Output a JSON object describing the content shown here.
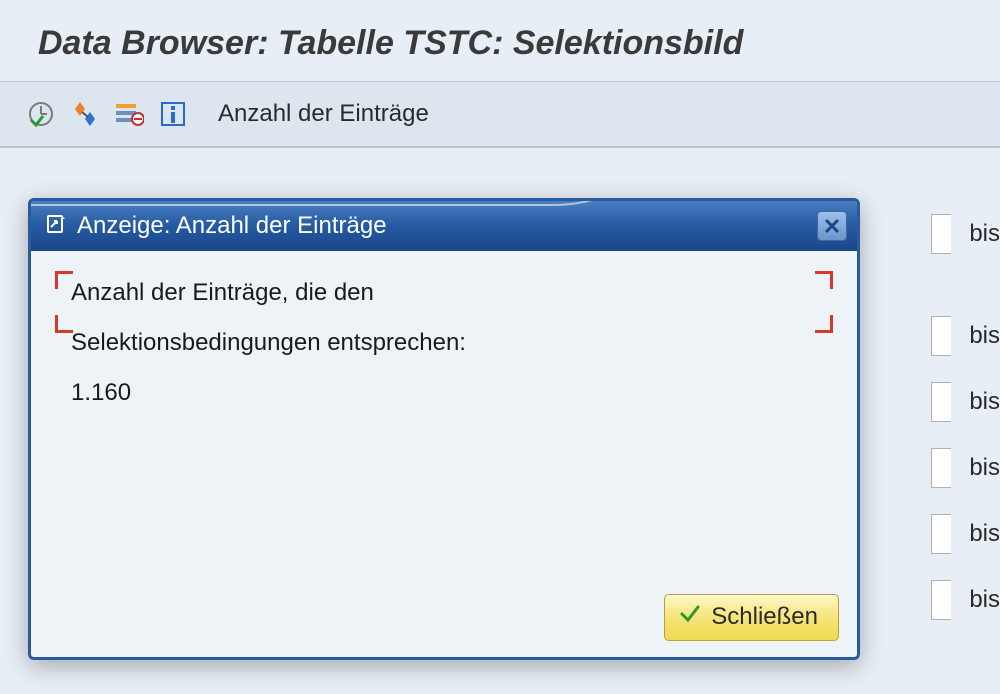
{
  "page": {
    "title": "Data Browser: Tabelle TSTC: Selektionsbild"
  },
  "toolbar": {
    "count_label": "Anzahl der Einträge"
  },
  "selection": {
    "bis_label": "bis",
    "rows": 6
  },
  "dialog": {
    "title": "Anzeige: Anzahl der Einträge",
    "line1": "Anzahl der Einträge, die den",
    "line2": "Selektionsbedingungen entsprechen:",
    "count": "1.160",
    "close_label": "Schließen"
  }
}
